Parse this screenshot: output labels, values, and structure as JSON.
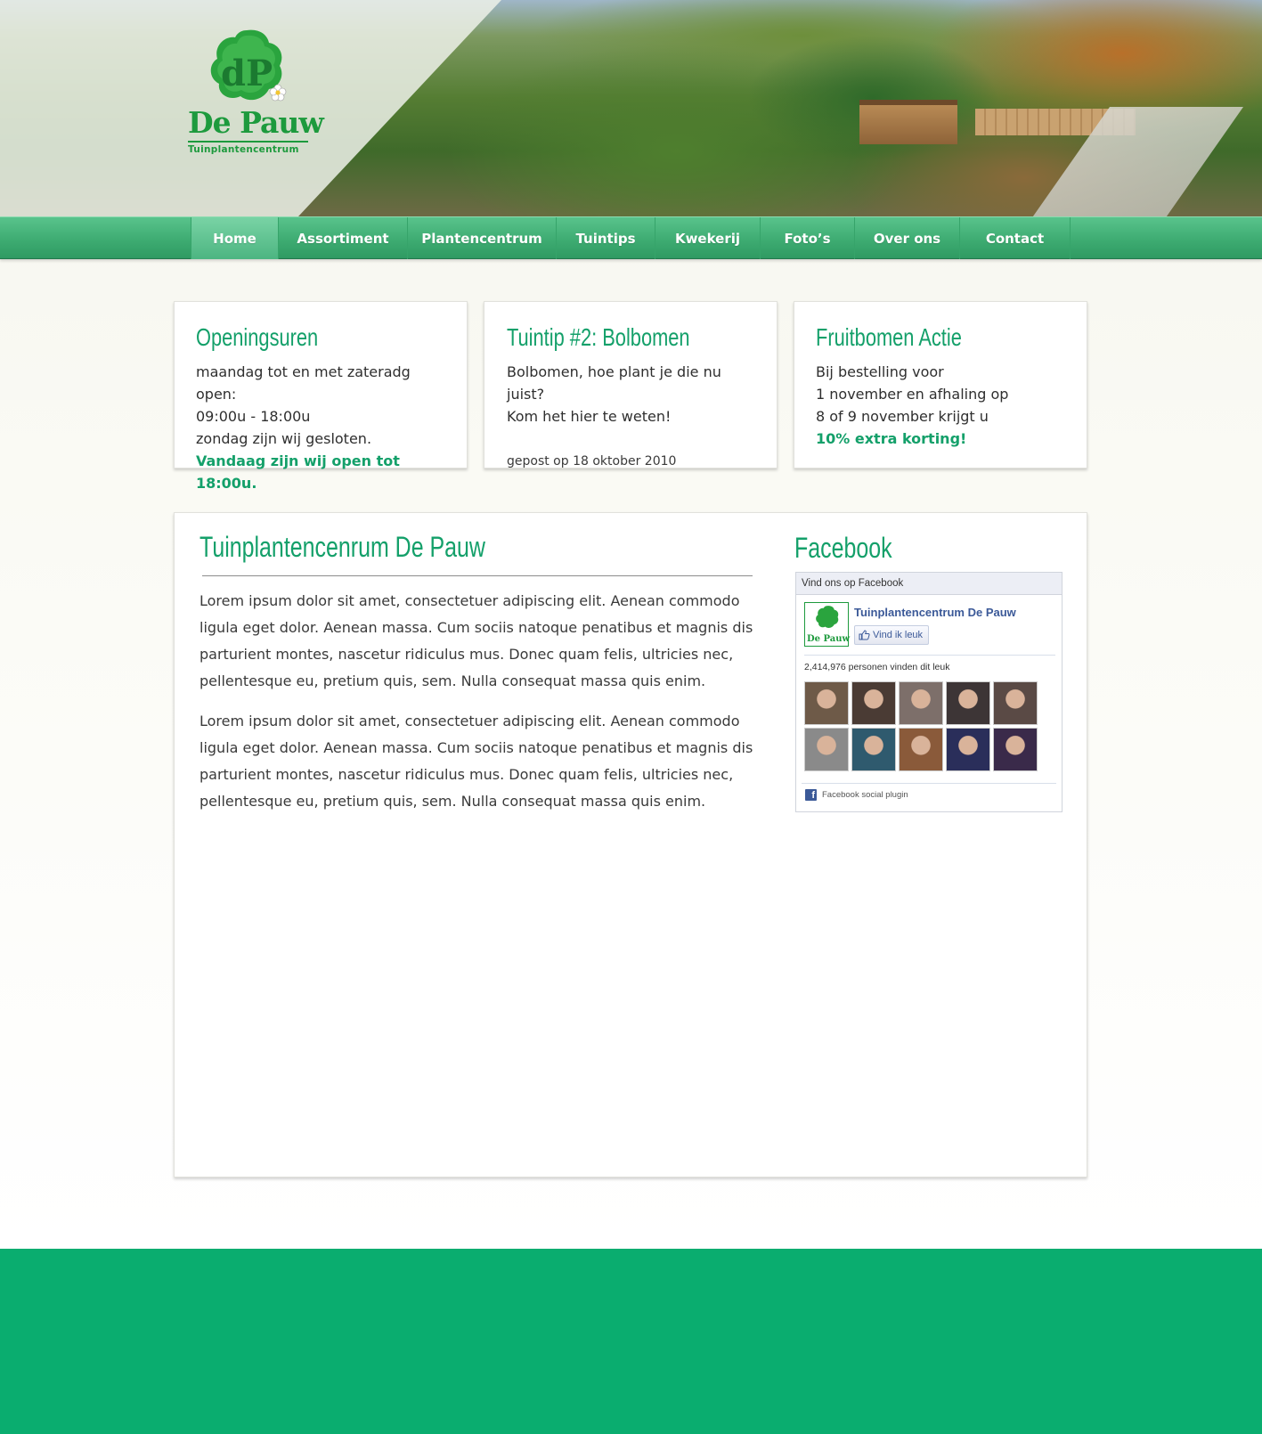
{
  "header": {
    "logo": {
      "brand": "De Pauw",
      "tagline": "Tuinplantencentrum",
      "monogram": "dP"
    }
  },
  "nav": {
    "items": [
      {
        "label": "Home",
        "active": true
      },
      {
        "label": "Assortiment",
        "active": false
      },
      {
        "label": "Plantencentrum",
        "active": false
      },
      {
        "label": "Tuintips",
        "active": false
      },
      {
        "label": "Kwekerij",
        "active": false
      },
      {
        "label": "Foto’s",
        "active": false
      },
      {
        "label": "Over ons",
        "active": false
      },
      {
        "label": "Contact",
        "active": false
      }
    ]
  },
  "cards": {
    "hours": {
      "title": "Openingsuren",
      "line1": "maandag tot en met zateradg open:",
      "line2": "09:00u - 18:00u",
      "line3": "zondag zijn wij gesloten.",
      "highlight": "Vandaag zijn wij open tot 18:00u."
    },
    "tip": {
      "title": "Tuintip #2: Bolbomen",
      "line1": "Bolbomen, hoe plant je die nu juist?",
      "line2": "Kom het hier te weten!",
      "posted": "gepost op 18 oktober 2010"
    },
    "promo": {
      "title": "Fruitbomen Actie",
      "line1": "Bij bestelling voor",
      "line2": "1 november en afhaling op",
      "line3": "8 of 9 november krijgt u",
      "highlight": "10% extra korting!"
    }
  },
  "main": {
    "title": "Tuinplantencenrum De Pauw",
    "paragraphs": [
      "Lorem ipsum dolor sit amet, consectetuer adipiscing elit. Aenean commodo ligula eget dolor. Aenean massa. Cum sociis natoque penatibus et magnis dis parturient montes, nascetur ridiculus mus. Donec quam felis, ultricies nec, pellentesque eu, pretium quis, sem. Nulla consequat massa quis enim.",
      "Lorem ipsum dolor sit amet, consectetuer adipiscing elit. Aenean commodo ligula eget dolor. Aenean massa. Cum sociis natoque penatibus et magnis dis parturient montes, nascetur ridiculus mus. Donec quam felis, ultricies nec, pellentesque eu, pretium quis, sem. Nulla consequat massa quis enim."
    ]
  },
  "facebook": {
    "section_title": "Facebook",
    "header": "Vind ons op Facebook",
    "page_name": "Tuinplantencentrum De Pauw",
    "like_label": "Vind ik leuk",
    "likes_text": "2,414,976 personen vinden dit leuk",
    "footer": "Facebook social plugin",
    "thumb_brand": "De Pauw",
    "faces": [
      "#6e5a48",
      "#4a3b34",
      "#7d6f6a",
      "#3d3536",
      "#5a4a45",
      "#8a8a8a",
      "#2f5a6e",
      "#8a5a3a",
      "#2a2e5a",
      "#3a2a4a"
    ]
  },
  "colors": {
    "accent": "#14a06a",
    "nav": "#3eac72",
    "footer": "#0aad6f",
    "facebook": "#3b5998"
  }
}
